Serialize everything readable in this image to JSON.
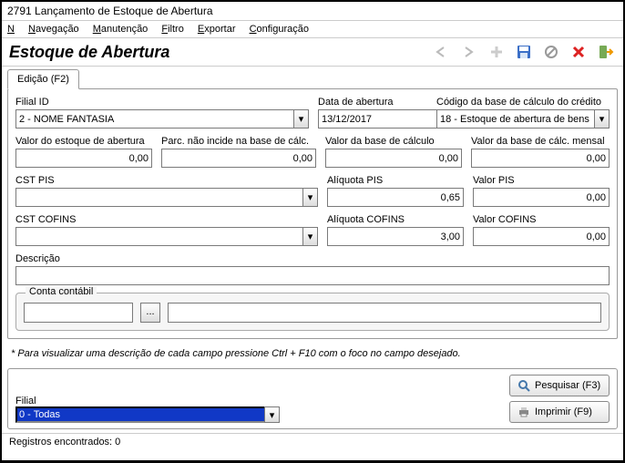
{
  "window": {
    "title": "2791 Lançamento de Estoque de Abertura"
  },
  "menu": {
    "nav": "Navegação",
    "manut": "Manutenção",
    "filtro": "Filtro",
    "exportar": "Exportar",
    "config": "Configuração"
  },
  "header": {
    "title": "Estoque de Abertura"
  },
  "tabs": {
    "edicao": "Edição (F2)"
  },
  "labels": {
    "filial_id": "Filial ID",
    "data_abertura": "Data de abertura",
    "codigo_base": "Código da base de cálculo do crédito",
    "valor_estoque": "Valor do estoque de abertura",
    "parc_nao_incide": "Parc. não incide na base de cálc.",
    "valor_base_calc": "Valor da base de cálculo",
    "valor_base_mensal": "Valor da base de cálc. mensal",
    "cst_pis": "CST PIS",
    "aliquota_pis": "Alíquota PIS",
    "valor_pis": "Valor PIS",
    "cst_cofins": "CST COFINS",
    "aliquota_cofins": "Alíquota COFINS",
    "valor_cofins": "Valor COFINS",
    "descricao": "Descrição",
    "conta_contabil": "Conta contábil",
    "filial": "Filial"
  },
  "values": {
    "filial_id": "2 - NOME FANTASIA",
    "data_abertura": "13/12/2017",
    "codigo_base": "18 - Estoque de abertura de bens",
    "valor_estoque": "0,00",
    "parc_nao_incide": "0,00",
    "valor_base_calc": "0,00",
    "valor_base_mensal": "0,00",
    "cst_pis": "",
    "aliquota_pis": "0,65",
    "valor_pis": "0,00",
    "cst_cofins": "",
    "aliquota_cofins": "3,00",
    "valor_cofins": "0,00",
    "descricao": "",
    "conta_code": "",
    "conta_desc": "",
    "filial_filter": "0 - Todas"
  },
  "hint": "* Para visualizar uma descrição de cada campo pressione Ctrl + F10 com o foco no campo desejado.",
  "buttons": {
    "pesquisar": "Pesquisar (F3)",
    "imprimir": "Imprimir (F9)"
  },
  "status": "Registros encontrados: 0"
}
